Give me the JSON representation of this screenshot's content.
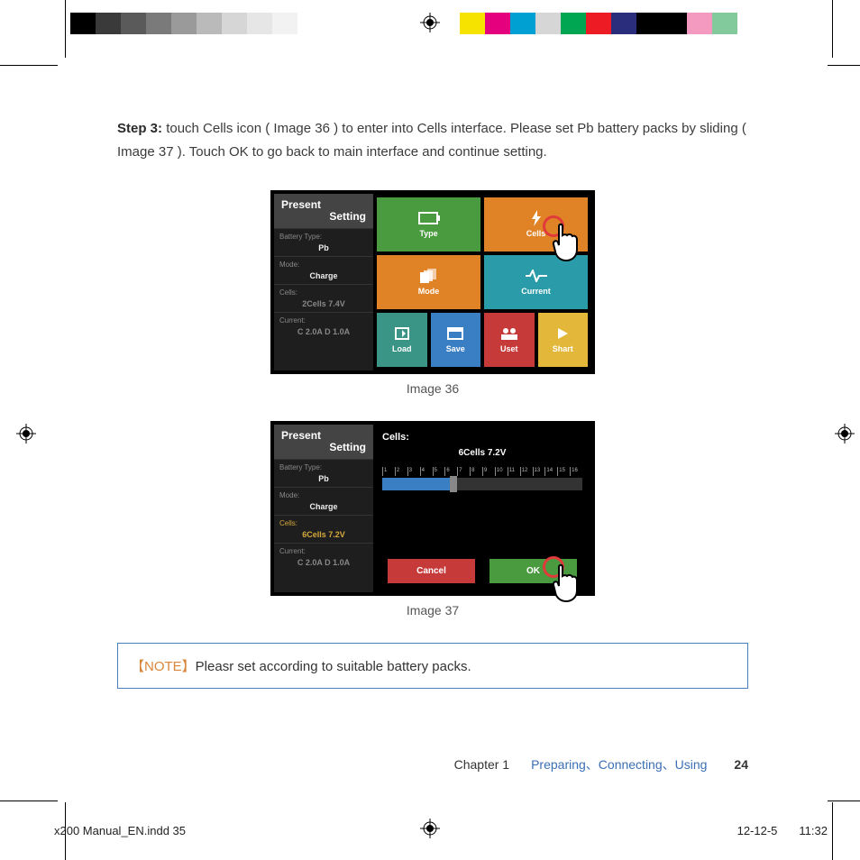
{
  "step": {
    "label": "Step 3:",
    "text": "touch Cells icon ( Image 36 ) to enter into Cells interface. Please set Pb battery packs by sliding ( Image 37 ). Touch OK to go back to main interface and continue setting."
  },
  "image36": {
    "caption": "Image 36",
    "panel_title_l1": "Present",
    "panel_title_l2": "Setting",
    "rows": {
      "battery_type_label": "Battery Type:",
      "battery_type_value": "Pb",
      "mode_label": "Mode:",
      "mode_value": "Charge",
      "cells_label": "Cells:",
      "cells_value": "2Cells  7.4V",
      "current_label": "Current:",
      "current_value": "C 2.0A  D 1.0A"
    },
    "tiles": {
      "type": "Type",
      "cells": "Cells",
      "mode": "Mode",
      "current": "Current",
      "load": "Load",
      "save": "Save",
      "uset": "Uset",
      "shart": "Shart"
    }
  },
  "image37": {
    "caption": "Image 37",
    "cells_title": "Cells:",
    "cells_reading": "6Cells  7.2V",
    "ticks": [
      "1",
      "2",
      "3",
      "4",
      "5",
      "6",
      "7",
      "8",
      "9",
      "10",
      "11",
      "12",
      "13",
      "14",
      "15",
      "16"
    ],
    "rows": {
      "battery_type_value": "Pb",
      "mode_value": "Charge",
      "cells_value": "6Cells  7.2V",
      "current_value": "C 2.0A  D 1.0A"
    },
    "buttons": {
      "cancel": "Cancel",
      "ok": "OK"
    }
  },
  "note": {
    "tag": "【NOTE】",
    "text": "Pleasr set according to suitable battery packs."
  },
  "footer": {
    "chapter": "Chapter 1",
    "topic": "Preparing、Connecting、Using",
    "page": "24"
  },
  "indd": {
    "file": "x200 Manual_EN.indd   35",
    "date": "12-12-5",
    "time": "11:32"
  },
  "colorbar_left": [
    "#000000",
    "#3a3a3a",
    "#5a5a5a",
    "#7a7a7a",
    "#9a9a9a",
    "#bababa",
    "#d6d6d6",
    "#e6e6e6",
    "#f2f2f2",
    "#ffffff",
    "#ffffff",
    "#ffffff"
  ],
  "colorbar_right": [
    "#f6e400",
    "#e5007e",
    "#00a0d2",
    "#d6d6d6",
    "#00a651",
    "#ed1c24",
    "#2a2c7c",
    "#000000",
    "#000000",
    "#f49ac1",
    "#82ca9c",
    "#ffffff"
  ]
}
